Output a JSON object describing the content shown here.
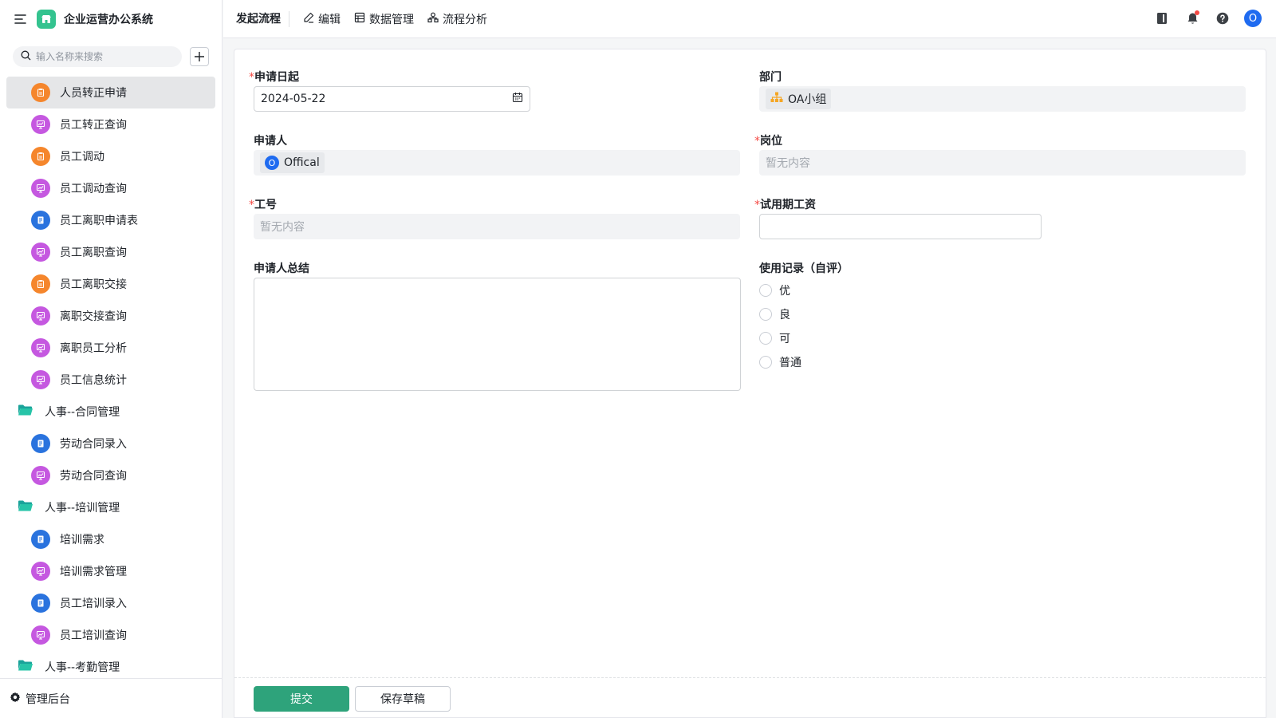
{
  "app": {
    "title": "企业运营办公系统"
  },
  "sidebar": {
    "search_placeholder": "输入名称来搜索",
    "items": [
      {
        "type": "item",
        "label": "人员转正申请",
        "icon": "form-icon",
        "color": "orange",
        "active": true
      },
      {
        "type": "item",
        "label": "员工转正查询",
        "icon": "report-icon",
        "color": "purple"
      },
      {
        "type": "item",
        "label": "员工调动",
        "icon": "form-icon",
        "color": "orange"
      },
      {
        "type": "item",
        "label": "员工调动查询",
        "icon": "report-icon",
        "color": "purple"
      },
      {
        "type": "item",
        "label": "员工离职申请表",
        "icon": "document-icon",
        "color": "blue"
      },
      {
        "type": "item",
        "label": "员工离职查询",
        "icon": "report-icon",
        "color": "purple"
      },
      {
        "type": "item",
        "label": "员工离职交接",
        "icon": "form-icon",
        "color": "orange"
      },
      {
        "type": "item",
        "label": "离职交接查询",
        "icon": "report-icon",
        "color": "purple"
      },
      {
        "type": "item",
        "label": "离职员工分析",
        "icon": "report-icon",
        "color": "purple"
      },
      {
        "type": "item",
        "label": "员工信息统计",
        "icon": "report-icon",
        "color": "purple"
      },
      {
        "type": "folder",
        "label": "人事--合同管理",
        "icon": "folder-open-icon"
      },
      {
        "type": "item",
        "label": "劳动合同录入",
        "icon": "document-icon",
        "color": "blue"
      },
      {
        "type": "item",
        "label": "劳动合同查询",
        "icon": "report-icon",
        "color": "purple"
      },
      {
        "type": "folder",
        "label": "人事--培训管理",
        "icon": "folder-open-icon"
      },
      {
        "type": "item",
        "label": "培训需求",
        "icon": "document-icon",
        "color": "blue"
      },
      {
        "type": "item",
        "label": "培训需求管理",
        "icon": "report-icon",
        "color": "purple"
      },
      {
        "type": "item",
        "label": "员工培训录入",
        "icon": "document-icon",
        "color": "blue"
      },
      {
        "type": "item",
        "label": "员工培训查询",
        "icon": "report-icon",
        "color": "purple"
      },
      {
        "type": "folder",
        "label": "人事--考勤管理",
        "icon": "folder-open-icon"
      }
    ],
    "footer_label": "管理后台"
  },
  "topbar": {
    "title": "发起流程",
    "links": [
      {
        "label": "编辑",
        "icon": "edit-icon"
      },
      {
        "label": "数据管理",
        "icon": "table-icon"
      },
      {
        "label": "流程分析",
        "icon": "flow-icon"
      }
    ],
    "avatar_letter": "O"
  },
  "form": {
    "date": {
      "label": "申请日起",
      "required": true,
      "value": "2024-05-22"
    },
    "department": {
      "label": "部门",
      "value": "OA小组"
    },
    "applicant": {
      "label": "申请人",
      "avatar_letter": "O",
      "value": "Offical"
    },
    "position": {
      "label": "岗位",
      "required": true,
      "placeholder": "暂无内容"
    },
    "employee_id": {
      "label": "工号",
      "required": true,
      "placeholder": "暂无内容"
    },
    "salary": {
      "label": "试用期工资",
      "required": true,
      "value": ""
    },
    "summary": {
      "label": "申请人总结",
      "value": ""
    },
    "record": {
      "label": "使用记录（自评）",
      "options": [
        "优",
        "良",
        "可",
        "普通"
      ]
    },
    "required_mark": "*"
  },
  "buttons": {
    "submit": "提交",
    "save_draft": "保存草稿"
  },
  "colors": {
    "primary": "#2ea37b",
    "orange": "#f5862c",
    "purple": "#c558e0",
    "blue": "#2a73de",
    "folder": "#1aa39a"
  }
}
